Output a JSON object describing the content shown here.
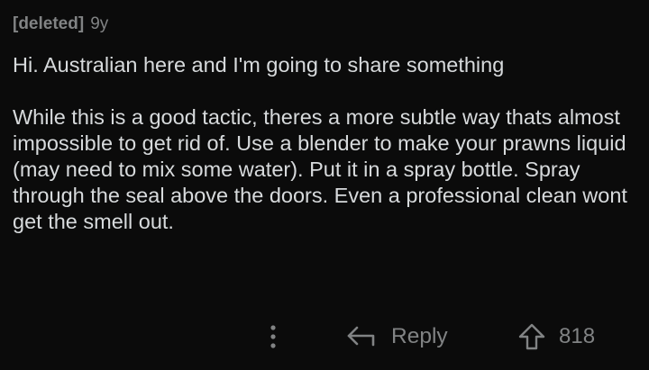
{
  "comment": {
    "author": "[deleted]",
    "age": "9y",
    "paragraphs": [
      "Hi. Australian here and I'm going to share something",
      "While this is a good tactic, theres a more subtle way thats almost impossible to get rid of. Use a blender to make your prawns liquid (may need to mix some water). Put it in a spray bottle. Spray through the seal above the doors. Even a professional clean wont get the smell out."
    ]
  },
  "actions": {
    "more_icon": "vertical-ellipsis-icon",
    "reply_icon": "reply-arrow-icon",
    "reply_label": "Reply",
    "upvote_icon": "upvote-arrow-icon",
    "score": "818"
  },
  "colors": {
    "background": "#0b0b0b",
    "text": "#d7dadc",
    "muted": "#818384"
  }
}
